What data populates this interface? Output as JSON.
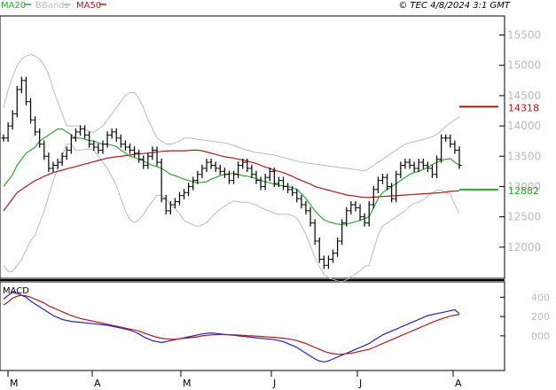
{
  "header": {
    "legend": [
      {
        "label": "MA20",
        "color": "#2ca82c"
      },
      {
        "label": "BBands",
        "color": "#bbbbbb"
      },
      {
        "label": "MA50",
        "color": "#b01818"
      }
    ],
    "copyright": "© TEC 4/8/2024 3:1 GMT"
  },
  "chart_data": {
    "type": "ohlc",
    "ylim": [
      11500,
      15800
    ],
    "yticks": [
      12000,
      12500,
      13000,
      13500,
      14000,
      14500,
      15000,
      15500
    ],
    "ytick_labels": [
      "12000",
      "12500",
      "13000",
      "13500",
      "14000",
      "14500",
      "15000",
      "15500"
    ],
    "months": [
      "M",
      "A",
      "M",
      "J",
      "J",
      "A"
    ],
    "badges": [
      {
        "label": "14318",
        "value": 14318,
        "color": "#b01818"
      },
      {
        "label": "12882",
        "value": 12950,
        "color": "#2ca82c"
      }
    ],
    "closes": [
      13800,
      14000,
      14200,
      14600,
      14750,
      14400,
      14100,
      13900,
      13700,
      13500,
      13300,
      13350,
      13400,
      13500,
      13600,
      13800,
      13900,
      13950,
      13850,
      13700,
      13650,
      13600,
      13700,
      13850,
      13900,
      13800,
      13700,
      13650,
      13600,
      13550,
      13450,
      13350,
      13500,
      13600,
      13400,
      12800,
      12600,
      12700,
      12750,
      12850,
      12900,
      13000,
      13100,
      13200,
      13300,
      13400,
      13350,
      13300,
      13250,
      13200,
      13100,
      13200,
      13350,
      13400,
      13300,
      13200,
      13100,
      13000,
      13150,
      13250,
      13050,
      13100,
      13000,
      12950,
      12900,
      12800,
      12700,
      12600,
      12400,
      12100,
      11800,
      11700,
      11800,
      11900,
      12100,
      12400,
      12600,
      12700,
      12650,
      12500,
      12400,
      12700,
      12950,
      13100,
      13150,
      13000,
      12800,
      13200,
      13350,
      13400,
      13350,
      13300,
      13400,
      13350,
      13300,
      13200,
      13450,
      13800,
      13800,
      13700,
      13600,
      13350
    ],
    "ma20": [
      13000,
      13100,
      13200,
      13350,
      13450,
      13550,
      13600,
      13650,
      13750,
      13800,
      13850,
      13900,
      13950,
      13950,
      13900,
      13850,
      13800,
      13800,
      13780,
      13760,
      13750,
      13720,
      13700,
      13700,
      13680,
      13660,
      13600,
      13550,
      13500,
      13480,
      13450,
      13420,
      13380,
      13350,
      13330,
      13300,
      13250,
      13200,
      13180,
      13150,
      13120,
      13100,
      13080,
      13060,
      13070,
      13080,
      13120,
      13150,
      13180,
      13200,
      13210,
      13220,
      13200,
      13180,
      13170,
      13150,
      13130,
      13100,
      13080,
      13060,
      13040,
      13020,
      13010,
      13000,
      12980,
      12950,
      12880,
      12800,
      12700,
      12600,
      12520,
      12450,
      12420,
      12400,
      12380,
      12370,
      12380,
      12400,
      12420,
      12440,
      12470,
      12500,
      12650,
      12800,
      12900,
      12950,
      13000,
      13050,
      13100,
      13150,
      13200,
      13230,
      13250,
      13280,
      13320,
      13360,
      13400,
      13430,
      13450,
      13460,
      13400,
      13350
    ],
    "ma50": [
      12600,
      12700,
      12800,
      12900,
      12950,
      13000,
      13050,
      13100,
      13130,
      13170,
      13200,
      13230,
      13250,
      13270,
      13290,
      13310,
      13330,
      13350,
      13370,
      13390,
      13410,
      13430,
      13450,
      13470,
      13480,
      13490,
      13500,
      13510,
      13520,
      13530,
      13540,
      13545,
      13550,
      13560,
      13570,
      13580,
      13585,
      13590,
      13590,
      13590,
      13590,
      13595,
      13600,
      13600,
      13590,
      13570,
      13550,
      13530,
      13510,
      13490,
      13480,
      13470,
      13450,
      13440,
      13420,
      13400,
      13380,
      13350,
      13320,
      13300,
      13270,
      13250,
      13230,
      13200,
      13170,
      13130,
      13100,
      13070,
      13040,
      13000,
      12980,
      12960,
      12940,
      12920,
      12900,
      12880,
      12860,
      12850,
      12840,
      12830,
      12820,
      12820,
      12825,
      12830,
      12835,
      12840,
      12845,
      12850,
      12855,
      12860,
      12865,
      12870,
      12875,
      12880,
      12885,
      12890,
      12895,
      12900,
      12910,
      12920,
      12925,
      12930
    ],
    "bb_upper": [
      14300,
      14600,
      14800,
      15000,
      15100,
      15150,
      15180,
      15150,
      15100,
      15000,
      14850,
      14600,
      14400,
      14200,
      14000,
      14000,
      14000,
      14000,
      13950,
      13900,
      13900,
      13950,
      14000,
      14100,
      14200,
      14300,
      14400,
      14500,
      14550,
      14550,
      14450,
      14300,
      14100,
      13950,
      13800,
      13750,
      13700,
      13700,
      13720,
      13750,
      13800,
      13800,
      13790,
      13780,
      13770,
      13760,
      13750,
      13740,
      13730,
      13720,
      13700,
      13680,
      13650,
      13620,
      13600,
      13580,
      13560,
      13550,
      13540,
      13530,
      13520,
      13500,
      13480,
      13460,
      13440,
      13420,
      13400,
      13390,
      13380,
      13370,
      13360,
      13350,
      13340,
      13330,
      13320,
      13310,
      13300,
      13290,
      13280,
      13270,
      13260,
      13300,
      13350,
      13400,
      13450,
      13500,
      13550,
      13600,
      13650,
      13700,
      13720,
      13740,
      13760,
      13780,
      13800,
      13820,
      13860,
      13920,
      14000,
      14050,
      14100,
      14150
    ],
    "bb_lower": [
      11700,
      11600,
      11600,
      11700,
      11800,
      11950,
      12100,
      12200,
      12400,
      12600,
      12850,
      13100,
      13300,
      13500,
      13700,
      13700,
      13600,
      13600,
      13610,
      13620,
      13600,
      13500,
      13400,
      13300,
      13160,
      13020,
      12800,
      12600,
      12450,
      12410,
      12450,
      12540,
      12660,
      12750,
      12860,
      12850,
      12800,
      12700,
      12640,
      12550,
      12440,
      12400,
      12370,
      12340,
      12370,
      12400,
      12490,
      12560,
      12630,
      12680,
      12720,
      12760,
      12750,
      12740,
      12740,
      12720,
      12700,
      12650,
      12620,
      12590,
      12560,
      12540,
      12540,
      12540,
      12520,
      12480,
      12360,
      12210,
      12020,
      11830,
      11680,
      11550,
      11500,
      11470,
      11440,
      11430,
      11460,
      11510,
      11560,
      11610,
      11680,
      11700,
      11950,
      12200,
      12350,
      12400,
      12450,
      12500,
      12550,
      12600,
      12680,
      12720,
      12740,
      12780,
      12840,
      12900,
      12940,
      12940,
      12900,
      12870,
      12700,
      12550
    ],
    "macd": [
      380,
      420,
      450,
      440,
      420,
      400,
      360,
      330,
      300,
      270,
      240,
      210,
      190,
      170,
      160,
      150,
      145,
      140,
      135,
      130,
      125,
      120,
      115,
      110,
      100,
      90,
      80,
      70,
      60,
      40,
      20,
      -10,
      -30,
      -50,
      -60,
      -70,
      -60,
      -50,
      -40,
      -30,
      -20,
      -10,
      0,
      10,
      20,
      25,
      30,
      25,
      20,
      15,
      10,
      5,
      0,
      -5,
      -10,
      -15,
      -20,
      -25,
      -30,
      -35,
      -40,
      -50,
      -60,
      -80,
      -100,
      -120,
      -150,
      -180,
      -210,
      -240,
      -260,
      -270,
      -260,
      -240,
      -220,
      -200,
      -180,
      -160,
      -140,
      -120,
      -100,
      -80,
      -50,
      -20,
      10,
      30,
      50,
      70,
      90,
      110,
      130,
      150,
      170,
      190,
      210,
      220,
      230,
      240,
      250,
      260,
      270,
      230
    ],
    "signal": [
      320,
      350,
      390,
      410,
      420,
      415,
      400,
      380,
      360,
      340,
      310,
      290,
      270,
      250,
      230,
      210,
      195,
      180,
      170,
      160,
      150,
      140,
      130,
      120,
      110,
      100,
      90,
      80,
      70,
      60,
      50,
      30,
      15,
      0,
      -15,
      -25,
      -30,
      -35,
      -35,
      -30,
      -25,
      -20,
      -15,
      -10,
      0,
      5,
      10,
      12,
      14,
      13,
      12,
      10,
      8,
      5,
      2,
      0,
      -3,
      -6,
      -10,
      -13,
      -16,
      -20,
      -25,
      -30,
      -40,
      -50,
      -65,
      -80,
      -100,
      -120,
      -140,
      -160,
      -175,
      -185,
      -190,
      -190,
      -185,
      -180,
      -170,
      -160,
      -150,
      -140,
      -120,
      -100,
      -80,
      -60,
      -40,
      -20,
      0,
      20,
      40,
      60,
      80,
      100,
      120,
      140,
      160,
      175,
      190,
      205,
      215,
      220
    ],
    "macd_ylim": [
      -350,
      550
    ],
    "macd_yticks": [
      0,
      200,
      400
    ],
    "macd_ytick_labels": [
      "000",
      "200",
      "400"
    ],
    "macd_title": "MACD"
  }
}
